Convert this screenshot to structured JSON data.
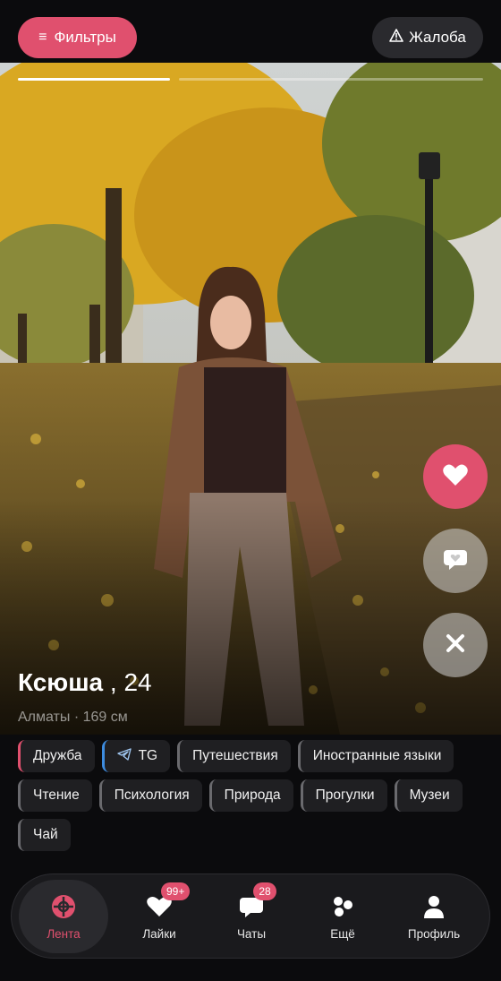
{
  "header": {
    "filters_label": "Фильтры",
    "filters_icon": "menu-icon",
    "report_label": "Жалоба",
    "report_icon": "warning-icon"
  },
  "photo": {
    "current_index": 1,
    "total": 2
  },
  "profile": {
    "name": "Ксюша",
    "age_separator": " , ",
    "age": "24",
    "meta": "Алматы · 169 см"
  },
  "actions": {
    "like_icon": "heart-icon",
    "message_icon": "chat-heart-icon",
    "skip_icon": "close-icon"
  },
  "tags": [
    {
      "label": "Дружба",
      "accent": "#e0506e"
    },
    {
      "label": "TG",
      "accent": "#3d8ce0",
      "icon": "telegram-icon"
    },
    {
      "label": "Путешествия"
    },
    {
      "label": "Иностранные языки"
    },
    {
      "label": "Чтение"
    },
    {
      "label": "Психология"
    },
    {
      "label": "Природа"
    },
    {
      "label": "Прогулки"
    },
    {
      "label": "Музеи"
    },
    {
      "label": "Чай"
    }
  ],
  "nav": {
    "items": [
      {
        "label": "Лента",
        "icon": "feed-icon",
        "active": true
      },
      {
        "label": "Лайки",
        "icon": "likes-icon",
        "badge": "99+"
      },
      {
        "label": "Чаты",
        "icon": "chats-icon",
        "badge": "28"
      },
      {
        "label": "Ещё",
        "icon": "more-icon"
      },
      {
        "label": "Профиль",
        "icon": "profile-icon"
      }
    ]
  },
  "colors": {
    "accent": "#e0506e",
    "background": "#0b0b0d",
    "telegram": "#3d8ce0"
  }
}
